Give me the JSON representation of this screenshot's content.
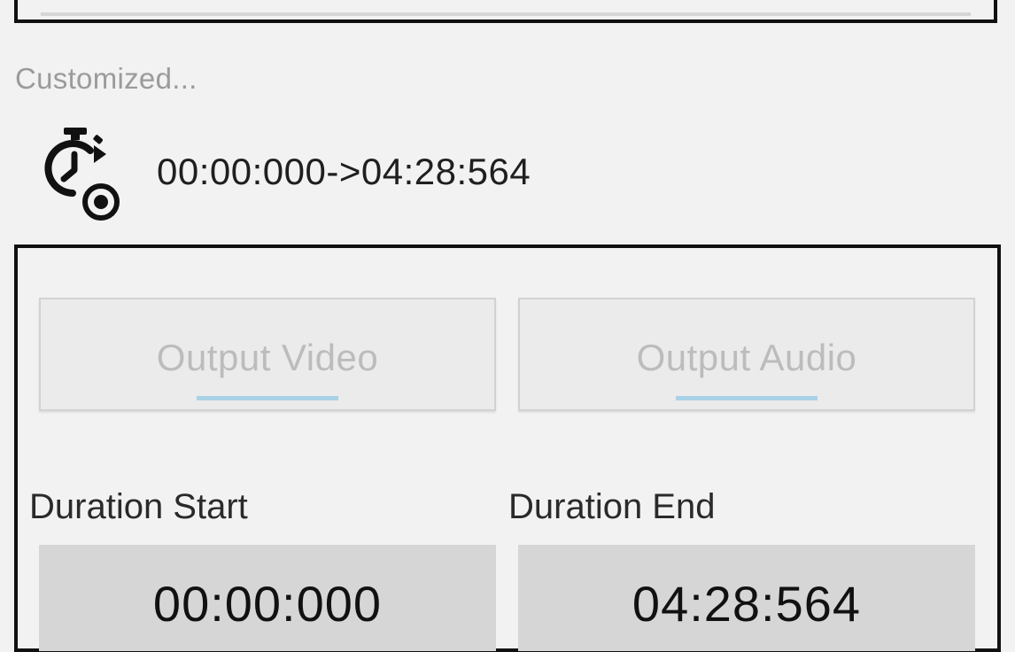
{
  "section": {
    "label": "Customized..."
  },
  "range": {
    "icon": "stopwatch-target-icon",
    "text": "00:00:000->04:28:564"
  },
  "buttons": {
    "output_video": "Output Video",
    "output_audio": "Output Audio"
  },
  "duration": {
    "start_label": "Duration Start",
    "start_value": "00:00:000",
    "end_label": "Duration End",
    "end_value": "04:28:564"
  },
  "colors": {
    "background": "#f2f2f2",
    "frame_border": "#111111",
    "button_bg": "#ebebeb",
    "button_text_disabled": "#bcbcbc",
    "button_accent": "#a9d2e6",
    "value_box_bg": "#d6d6d6"
  }
}
